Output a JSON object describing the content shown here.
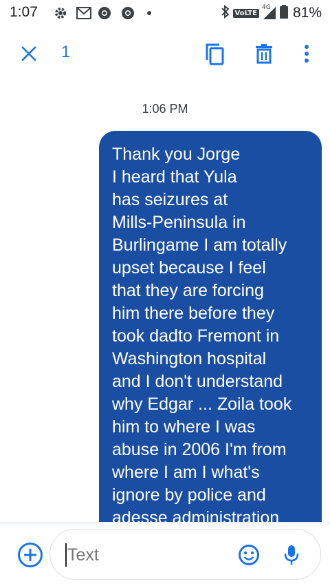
{
  "status_bar": {
    "time": "1:07",
    "network_label": "VoLTE",
    "network_type": "4G",
    "battery_text": "81%",
    "icons": [
      "settings-icon",
      "gmail-icon",
      "chrome-icon",
      "chrome-icon",
      "notification-dot-icon",
      "bluetooth-icon",
      "signal-icon",
      "battery-icon"
    ]
  },
  "action_bar": {
    "close_icon": "close-icon",
    "selected_count": "1",
    "copy_icon": "copy-icon",
    "delete_icon": "delete-icon",
    "more_icon": "more-vert-icon",
    "accent_color": "#1a73e8"
  },
  "conversation": {
    "timestamp": "1:06 PM",
    "message": {
      "bubble_color": "#1a4ea3",
      "lines": [
        "Thank you Jorge",
        "I heard that Yula",
        "has seizures at",
        "Mills-Peninsula in",
        "Burlingame I am totally",
        "upset because I feel",
        "that they are forcing",
        "him there before they",
        "took dadto Fremont in",
        "Washington hospital",
        "and I don't understand",
        "why Edgar ... Zoila  took",
        "him to where I was",
        "abuse in 2006 I'm from",
        "where I am I what's",
        "ignore by police and",
        "adesse administration"
      ]
    }
  },
  "compose": {
    "placeholder": "Text",
    "add_icon": "add-circle-icon",
    "emoji_icon": "emoji-icon",
    "mic_icon": "mic-icon"
  }
}
